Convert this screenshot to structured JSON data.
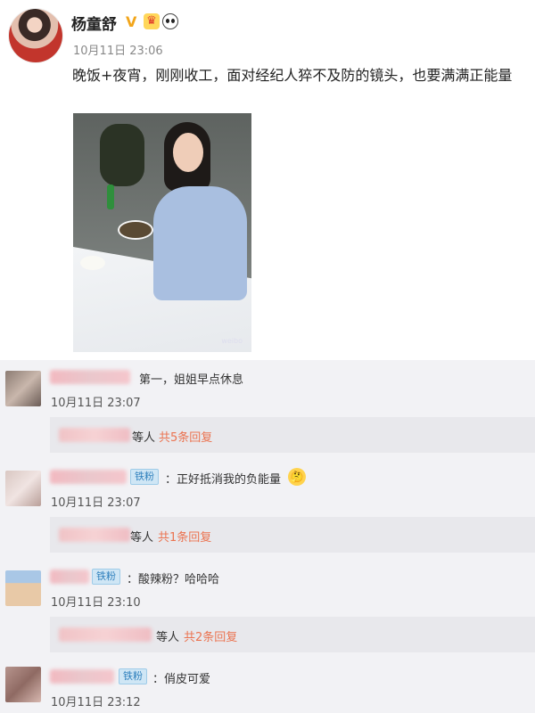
{
  "post": {
    "author": "杨童舒",
    "timestamp": "10月11日 23:06",
    "text": "晚饭+夜宵，刚刚收工，面对经纪人猝不及防的镜头，也要满满正能量",
    "photo_watermark": "weibo",
    "badge_v": "V",
    "badge_crown": "♛"
  },
  "comments": [
    {
      "text": "第一，姐姐早点休息",
      "time": "10月11日 23:07",
      "reply": {
        "suffix": "等人",
        "link": "共5条回复"
      }
    },
    {
      "fan_badge": "铁粉",
      "text": "：正好抵消我的负能量",
      "time": "10月11日 23:07",
      "reply": {
        "suffix": "等人",
        "link": "共1条回复"
      }
    },
    {
      "fan_badge": "铁粉",
      "text": "：酸辣粉？哈哈哈",
      "time": "10月11日 23:10",
      "reply": {
        "suffix": "等人",
        "link": "共2条回复"
      }
    },
    {
      "fan_badge": "铁粉",
      "text": "：俏皮可爱",
      "time": "10月11日 23:12"
    }
  ],
  "icons": {
    "verified": "verified-v-icon",
    "vip": "crown-icon",
    "panda": "panda-icon",
    "thinking_emoji": "thinking-emoji-icon"
  },
  "colors": {
    "link_orange": "#eb7350",
    "verified_gold": "#f2a51a",
    "fan_badge_blue": "#2e7fbc"
  }
}
